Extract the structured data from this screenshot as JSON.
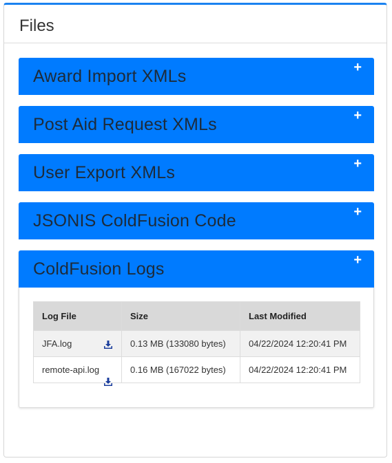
{
  "panel": {
    "title": "Files"
  },
  "accordion": {
    "items": [
      {
        "label": "Award Import XMLs",
        "toggle": "+"
      },
      {
        "label": "Post Aid Request XMLs",
        "toggle": "+"
      },
      {
        "label": "User Export XMLs",
        "toggle": "+"
      },
      {
        "label": "JSONIS ColdFusion Code",
        "toggle": "+"
      },
      {
        "label": "ColdFusion Logs",
        "toggle": "+"
      }
    ]
  },
  "logs_table": {
    "headers": [
      "Log File",
      "Size",
      "Last Modified"
    ],
    "rows": [
      {
        "file": "JFA.log",
        "size": "0.13 MB (133080 bytes)",
        "modified": "04/22/2024 12:20:41 PM",
        "icon": "download-icon"
      },
      {
        "file": "remote-api.log",
        "size": "0.16 MB (167022 bytes)",
        "modified": "04/22/2024 12:20:41 PM",
        "icon": "download-icon"
      }
    ]
  },
  "colors": {
    "accent": "#007bff",
    "top_border": "#1a82f0",
    "header_title_text": "#1d2b3a",
    "download_icon": "#1a3d9c"
  }
}
